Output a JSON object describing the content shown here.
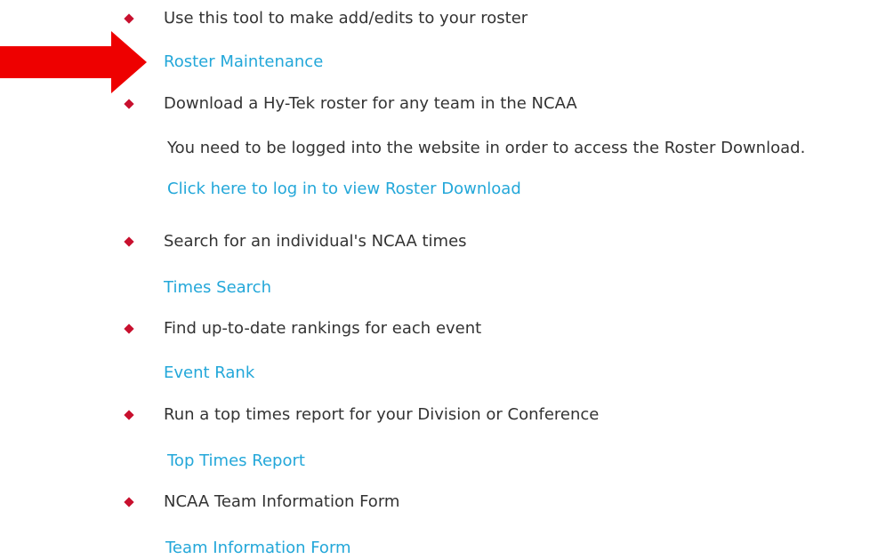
{
  "items": [
    {
      "description": "Use this tool to make add/edits to your roster",
      "link": "Roster Maintenance"
    },
    {
      "description": "Download a Hy-Tek roster for any team in the NCAA",
      "note": "You need to be logged into the website in order to access the Roster Download.",
      "link": "Click here to log in to view Roster Download"
    },
    {
      "description": "Search for an individual's NCAA times",
      "link": "Times Search"
    },
    {
      "description": "Find up-to-date rankings for each event",
      "link": "Event Rank"
    },
    {
      "description": "Run a top times report for your Division or Conference",
      "link": "Top Times Report"
    },
    {
      "description": "NCAA Team Information Form",
      "link": "Team Information Form"
    }
  ],
  "colors": {
    "bullet": "#c8102e",
    "link": "#23a7d9",
    "text": "#333333",
    "arrow": "#ee0000"
  },
  "icons": {
    "bullet": "diamond-bullet-icon",
    "arrow": "red-arrow-icon"
  }
}
